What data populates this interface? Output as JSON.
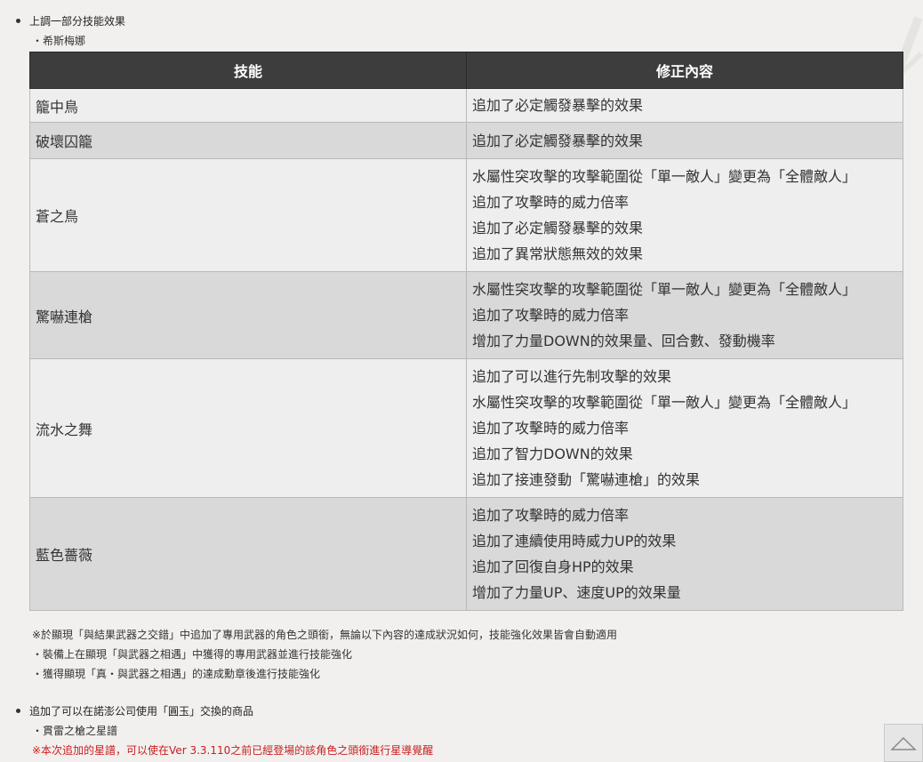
{
  "section1": {
    "bullet": "上調一部分技能效果",
    "character": "・希斯梅娜"
  },
  "table": {
    "headers": [
      "技能",
      "修正內容"
    ],
    "rows": [
      {
        "skill": "籠中鳥",
        "effects": [
          "追加了必定觸發暴擊的效果"
        ]
      },
      {
        "skill": "破壞囚籠",
        "effects": [
          "追加了必定觸發暴擊的效果"
        ]
      },
      {
        "skill": "蒼之鳥",
        "effects": [
          "水屬性突攻擊的攻擊範圍從「單一敵人」變更為「全體敵人」",
          "追加了攻擊時的威力倍率",
          "追加了必定觸發暴擊的效果",
          "追加了異常狀態無效的效果"
        ]
      },
      {
        "skill": "驚嚇連槍",
        "effects": [
          "水屬性突攻擊的攻擊範圍從「單一敵人」變更為「全體敵人」",
          "追加了攻擊時的威力倍率",
          "增加了力量DOWN的效果量、回合數、發動機率"
        ]
      },
      {
        "skill": "流水之舞",
        "effects": [
          "追加了可以進行先制攻擊的效果",
          "水屬性突攻擊的攻擊範圍從「單一敵人」變更為「全體敵人」",
          "追加了攻擊時的威力倍率",
          "追加了智力DOWN的效果",
          "追加了接連發動「驚嚇連槍」的效果"
        ]
      },
      {
        "skill": "藍色薔薇",
        "effects": [
          "追加了攻擊時的威力倍率",
          "追加了連續使用時威力UP的效果",
          "追加了回復自身HP的效果",
          "增加了力量UP、速度UP的效果量"
        ]
      }
    ]
  },
  "notes": [
    "※於顯現「與結果武器之交錯」中追加了專用武器的角色之頭銜，無論以下內容的達成狀況如何，技能強化效果皆會自動適用",
    "・裝備上在顯現「與武器之相遇」中獲得的專用武器並進行技能強化",
    "・獲得顯現「真・與武器之相遇」的達成勳章後進行技能強化"
  ],
  "section2": {
    "bullet": "追加了可以在諾澎公司使用「圓玉」交換的商品",
    "item": "・貫雷之槍之星譜",
    "red_note": "※本次追加的星譜，可以使在Ver 3.3.110之前已經登場的該角色之頭銜進行星導覺醒"
  },
  "icons": {
    "scroll_top": "triangle-up-icon"
  },
  "colors": {
    "header_bg": "#3d3d3d",
    "red_note": "#c81e1e"
  }
}
